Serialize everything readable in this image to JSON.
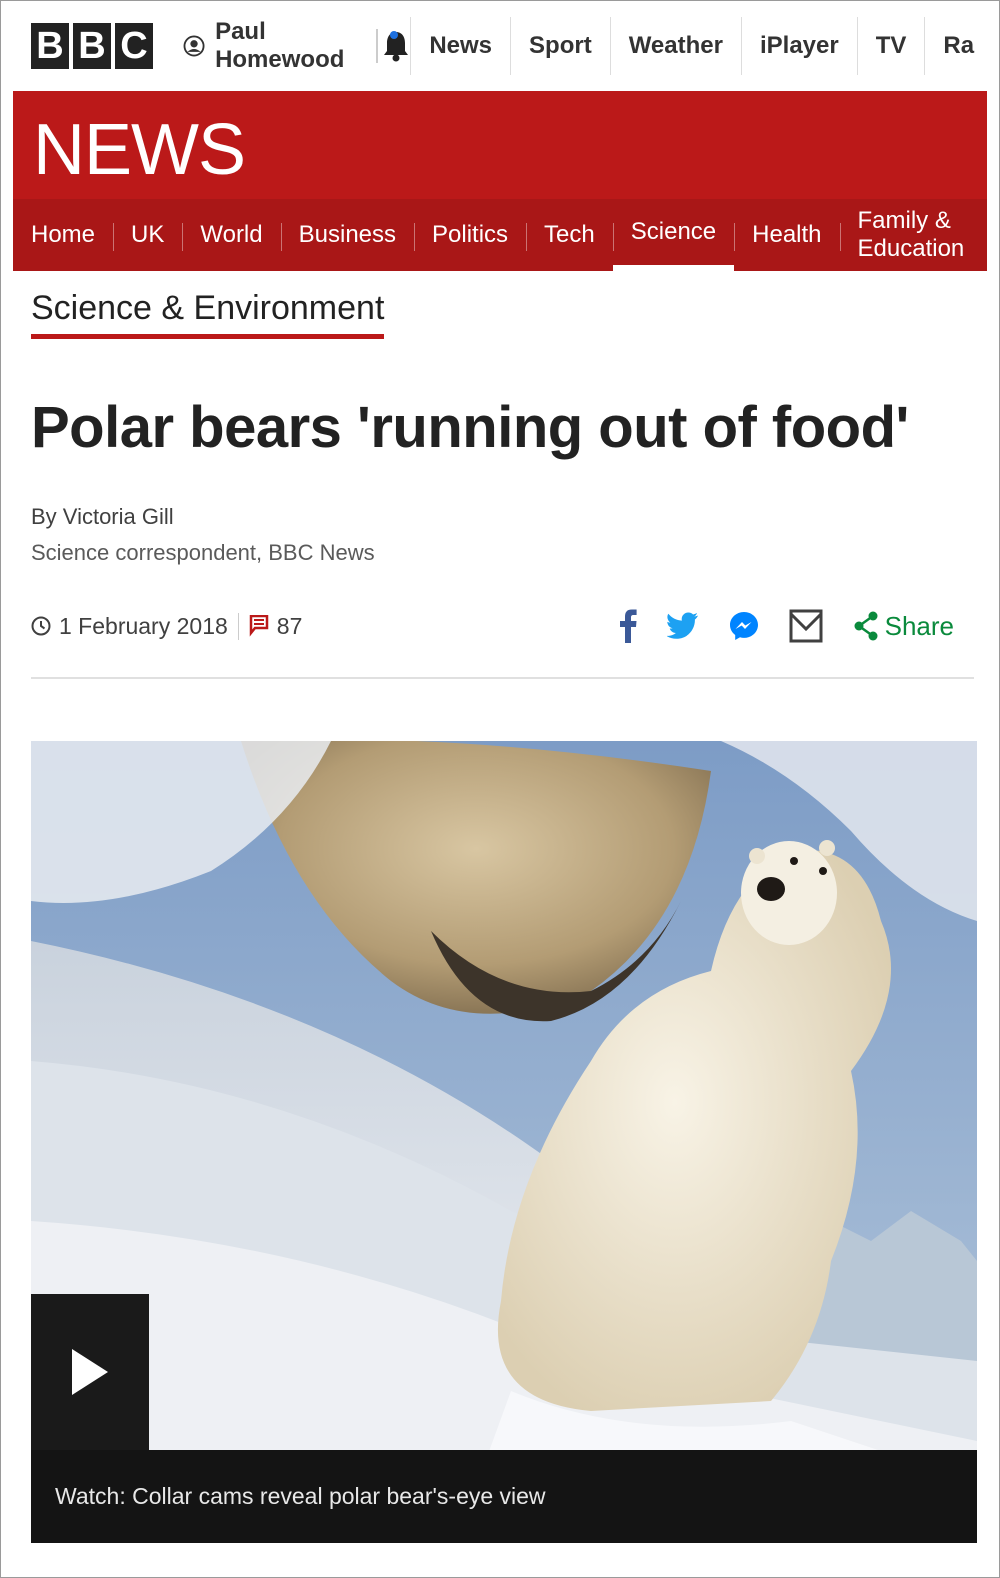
{
  "topbar": {
    "logo_letters": [
      "B",
      "B",
      "C"
    ],
    "account_name": "Paul Homewood",
    "links": [
      "News",
      "Sport",
      "Weather",
      "iPlayer",
      "TV",
      "Ra"
    ]
  },
  "banner": {
    "wordmark": "NEWS",
    "nav": [
      "Home",
      "UK",
      "World",
      "Business",
      "Politics",
      "Tech",
      "Science",
      "Health",
      "Family & Education"
    ],
    "active_nav": "Science"
  },
  "article": {
    "section": "Science & Environment",
    "headline": "Polar bears 'running out of food'",
    "author": "By Victoria Gill",
    "role": "Science correspondent, BBC News",
    "date": "1 February 2018",
    "comment_count": "87",
    "share_label": "Share"
  },
  "media": {
    "caption": "Watch: Collar cams reveal polar bear's-eye view"
  },
  "colors": {
    "brand_red": "#bb1919",
    "nav_red": "#a91717",
    "share_green": "#0a8a3c",
    "facebook_blue": "#3b5998",
    "twitter_blue": "#1da1f2"
  }
}
